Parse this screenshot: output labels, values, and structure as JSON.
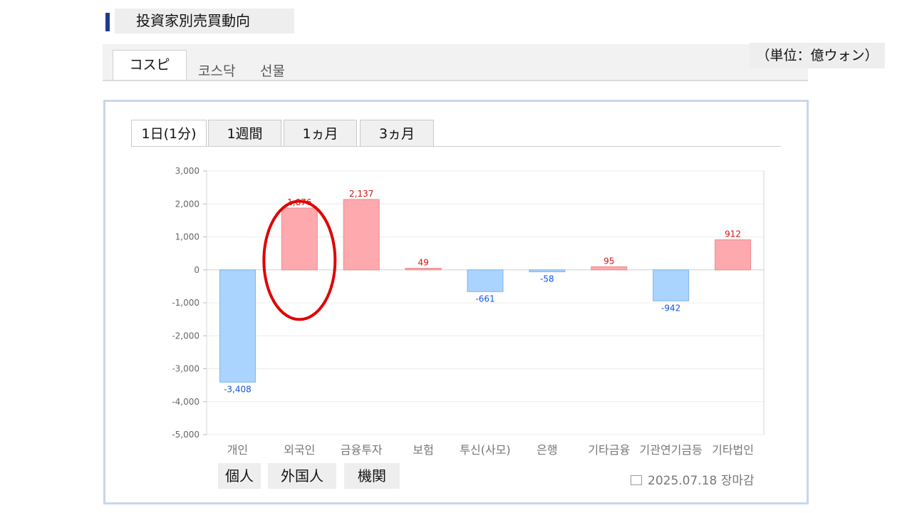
{
  "header": {
    "title": "投資家別売買動向"
  },
  "market_tabs": [
    "コスピ",
    "코스닥",
    "선물"
  ],
  "unit_label": "（単位：億ウォン）",
  "period_tabs": [
    "1日(1分)",
    "1週間",
    "1ヵ月",
    "3ヵ月"
  ],
  "investor_groups_jp": [
    "個人",
    "外国人",
    "機関"
  ],
  "date_text": "2025.07.18 장마감",
  "colors": {
    "positive": "#fda9ad",
    "negative": "#aad4fd",
    "pos_label": "#dd1111",
    "neg_label": "#1155dd",
    "highlight": "#e00000"
  },
  "chart_data": {
    "type": "bar",
    "categories": [
      "개인",
      "외국인",
      "금융투자",
      "보험",
      "투신(사모)",
      "은행",
      "기타금융",
      "기관연기금등",
      "기타법인"
    ],
    "values": [
      -3408,
      1876,
      2137,
      49,
      -661,
      -58,
      95,
      -942,
      912
    ],
    "value_labels": [
      "-3,408",
      "1,876",
      "2,137",
      "49",
      "-661",
      "-58",
      "95",
      "-942",
      "912"
    ],
    "yticks": [
      "3,000",
      "2,000",
      "1,000",
      "0",
      "-1,000",
      "-2,000",
      "-3,000",
      "-4,000",
      "-5,000"
    ],
    "ytick_values": [
      3000,
      2000,
      1000,
      0,
      -1000,
      -2000,
      -3000,
      -4000,
      -5000
    ],
    "ylim": [
      -5000,
      3000
    ],
    "grid": true,
    "highlighted_category": "외국인"
  }
}
